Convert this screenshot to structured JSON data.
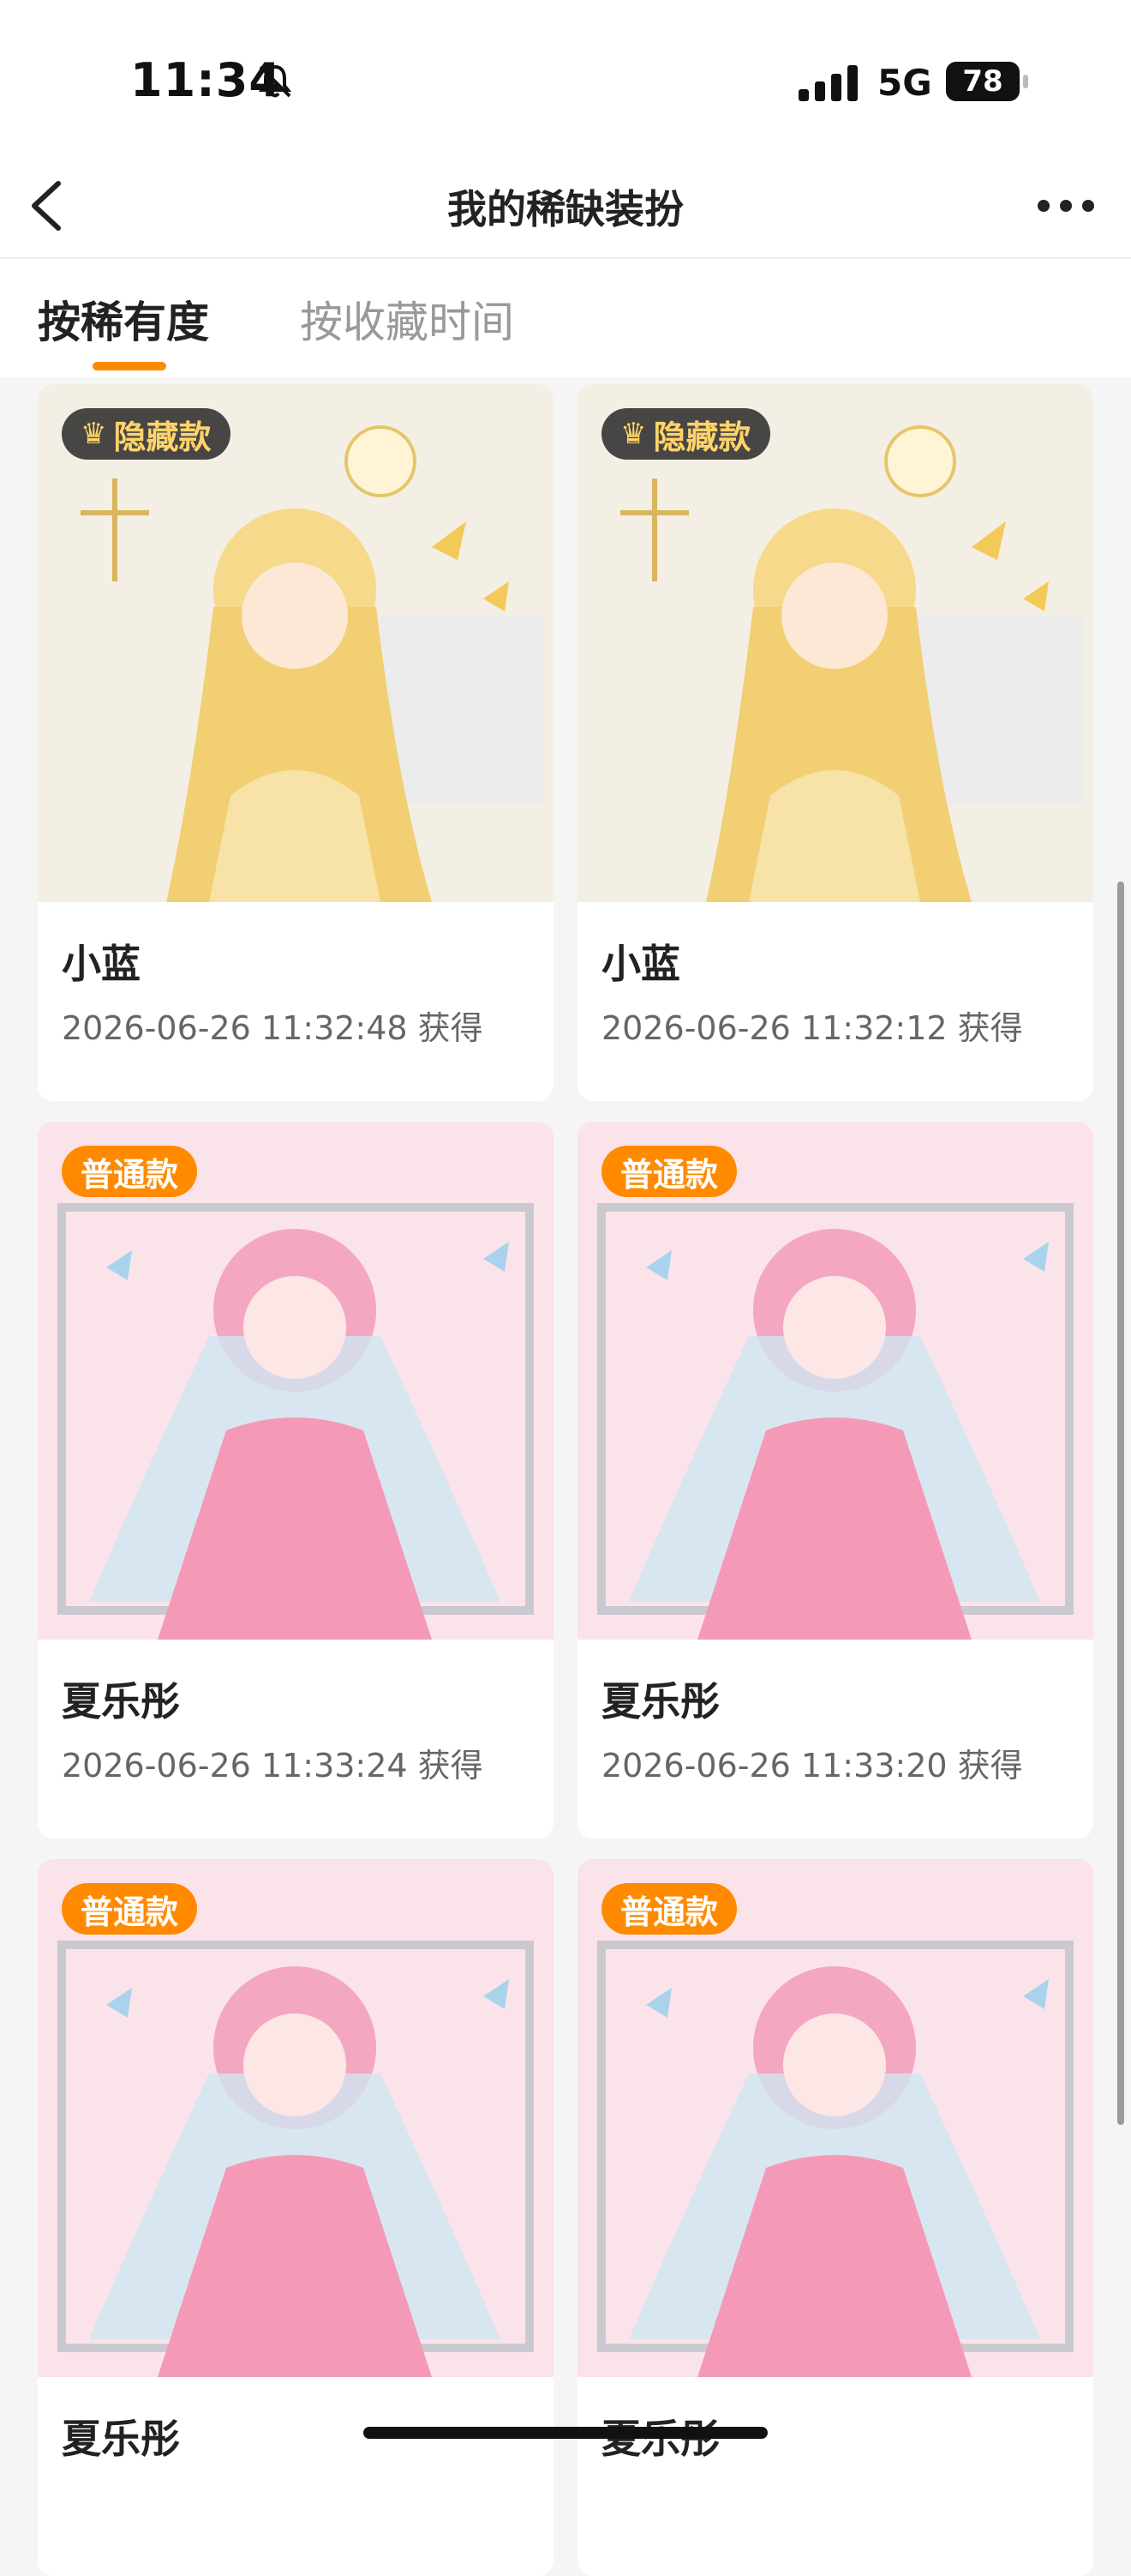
{
  "status_bar": {
    "time": "11:34",
    "network": "5G",
    "battery": "78"
  },
  "nav": {
    "title": "我的稀缺装扮"
  },
  "tabs": [
    {
      "label": "按稀有度",
      "active": true
    },
    {
      "label": "按收藏时间",
      "active": false
    }
  ],
  "cards": [
    {
      "badge": "隐藏款",
      "badge_type": "hidden",
      "name": "小蓝",
      "date": "2026-06-26 11:32:48 获得"
    },
    {
      "badge": "隐藏款",
      "badge_type": "hidden",
      "name": "小蓝",
      "date": "2026-06-26 11:32:12 获得"
    },
    {
      "badge": "普通款",
      "badge_type": "normal",
      "name": "夏乐彤",
      "date": "2026-06-26 11:33:24 获得"
    },
    {
      "badge": "普通款",
      "badge_type": "normal",
      "name": "夏乐彤",
      "date": "2026-06-26 11:33:20 获得"
    },
    {
      "badge": "普通款",
      "badge_type": "normal",
      "name": "夏乐彤",
      "date": ""
    },
    {
      "badge": "普通款",
      "badge_type": "normal",
      "name": "夏乐彤",
      "date": ""
    }
  ],
  "colors": {
    "accent": "#ff8a00",
    "hidden_badge_text": "#ffd36a"
  }
}
